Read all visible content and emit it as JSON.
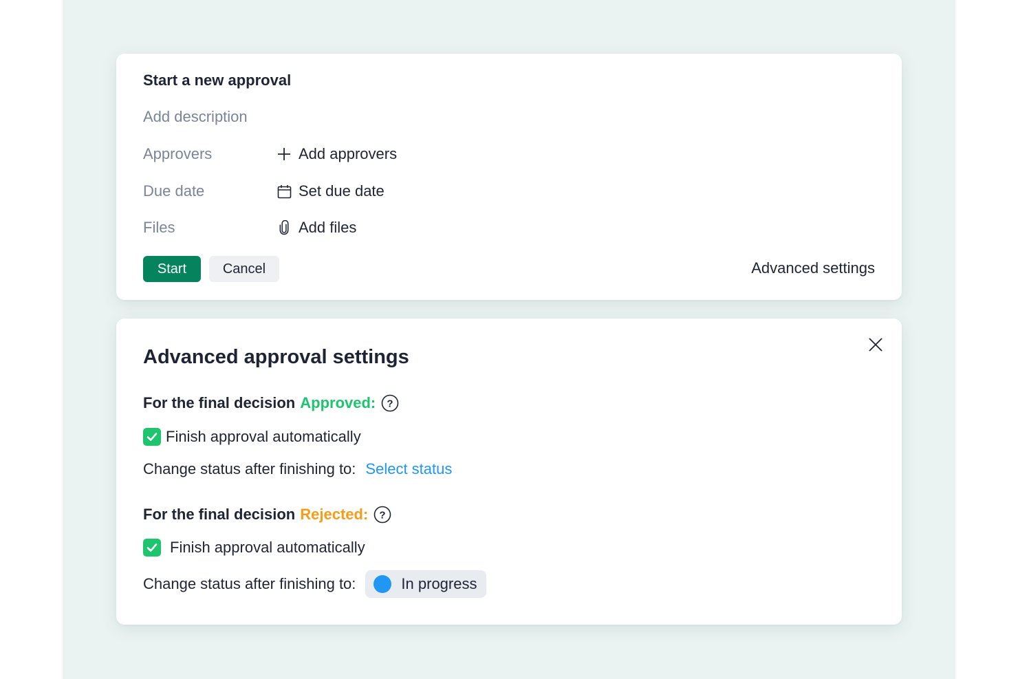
{
  "form": {
    "title": "Start a new approval",
    "description_placeholder": "Add description",
    "rows": [
      {
        "label": "Approvers",
        "action": "Add approvers",
        "icon": "plus-icon"
      },
      {
        "label": "Due date",
        "action": "Set due date",
        "icon": "calendar-icon"
      },
      {
        "label": "Files",
        "action": "Add files",
        "icon": "paperclip-icon"
      }
    ],
    "start_label": "Start",
    "cancel_label": "Cancel",
    "advanced_link": "Advanced settings"
  },
  "advanced": {
    "title": "Advanced approval settings",
    "approved": {
      "prefix": "For the final decision",
      "decision": "Approved:",
      "checkbox_label": "Finish approval automatically",
      "checked": true,
      "status_label": "Change status after finishing to:",
      "status_value": "Select status"
    },
    "rejected": {
      "prefix": "For the final decision",
      "decision": "Rejected:",
      "checkbox_label": "Finish approval automatically",
      "checked": true,
      "status_label": "Change status after finishing to:",
      "status_value": "In progress"
    }
  },
  "colors": {
    "primary_button": "#05835d",
    "approved": "#1fc46e",
    "rejected": "#f59c1a",
    "link": "#2196f3",
    "status_dot": "#2196f3"
  }
}
